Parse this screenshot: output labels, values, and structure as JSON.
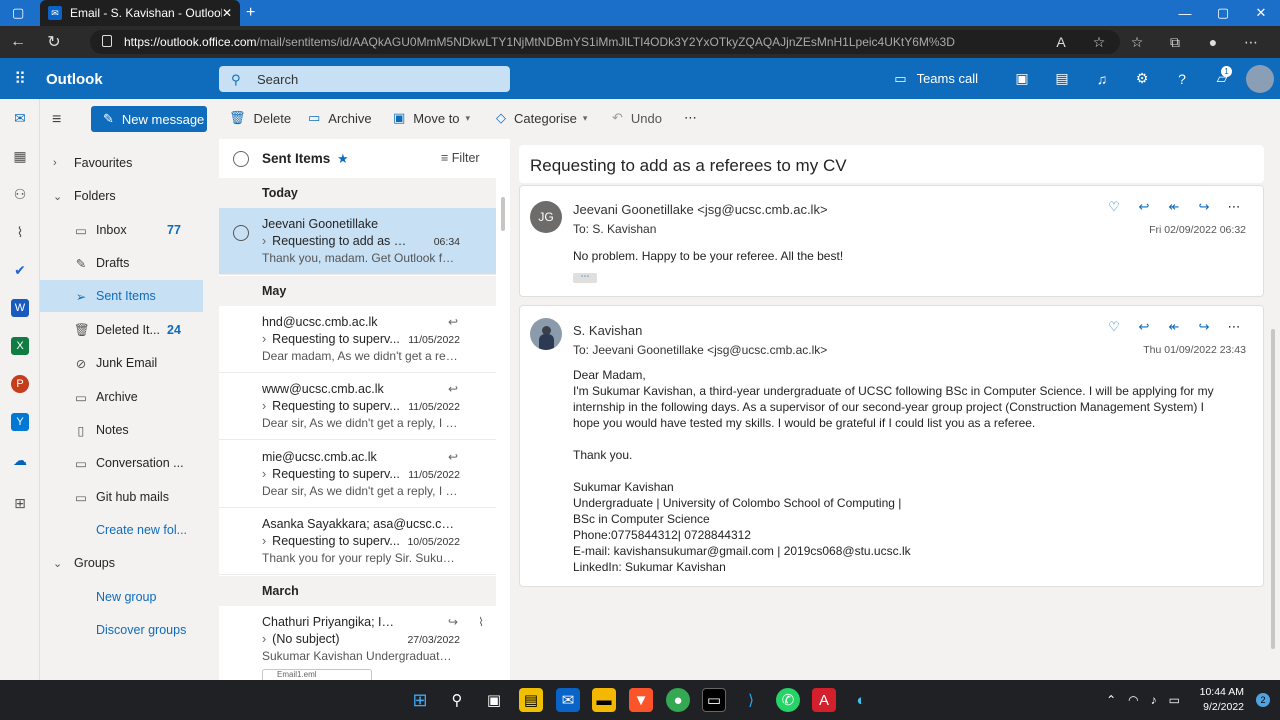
{
  "browser": {
    "tab_title": "Email - S. Kavishan - Outlook",
    "url_host": "https://outlook.office.com",
    "url_path": "/mail/sentitems/id/AAQkAGU0MmM5NDkwLTY1NjMtNDBmYS1iMmJlLTI4ODk3Y2YxOTkyZQAQAJjnZEsMnH1Lpeic4UKtY6M%3D"
  },
  "header": {
    "app_name": "Outlook",
    "search_placeholder": "Search",
    "teams_call": "Teams call",
    "notification_badge": "1"
  },
  "commands": {
    "new_message": "New message",
    "delete": "Delete",
    "archive": "Archive",
    "move_to": "Move to",
    "categorise": "Categorise",
    "undo": "Undo"
  },
  "folders": {
    "favourites": "Favourites",
    "folders": "Folders",
    "items": [
      {
        "label": "Inbox",
        "count": "77"
      },
      {
        "label": "Drafts",
        "count": ""
      },
      {
        "label": "Sent Items",
        "count": ""
      },
      {
        "label": "Deleted It...",
        "count": "24"
      },
      {
        "label": "Junk Email",
        "count": ""
      },
      {
        "label": "Archive",
        "count": ""
      },
      {
        "label": "Notes",
        "count": ""
      },
      {
        "label": "Conversation ...",
        "count": ""
      },
      {
        "label": "Git hub mails",
        "count": ""
      }
    ],
    "create_new": "Create new fol...",
    "groups": "Groups",
    "new_group": "New group",
    "discover_groups": "Discover groups"
  },
  "message_list": {
    "title": "Sent Items",
    "filter": "Filter",
    "groups": [
      "Today",
      "May",
      "March"
    ],
    "messages": [
      {
        "from": "Jeevani Goonetillake",
        "subject": "Requesting to add as a ref...",
        "date": "06:34",
        "preview": "Thank you, madam. Get Outlook for ..."
      },
      {
        "from": "hnd@ucsc.cmb.ac.lk",
        "subject": "Requesting to superv...",
        "date": "11/05/2022",
        "preview": "Dear madam, As we didn't get a repl..."
      },
      {
        "from": "www@ucsc.cmb.ac.lk",
        "subject": "Requesting to superv...",
        "date": "11/05/2022",
        "preview": "Dear sir, As we didn't get a reply, I re..."
      },
      {
        "from": "mie@ucsc.cmb.ac.lk",
        "subject": "Requesting to superv...",
        "date": "11/05/2022",
        "preview": "Dear sir, As we didn't get a reply, I re..."
      },
      {
        "from": "Asanka Sayakkara; asa@ucsc.cmb.ac....",
        "subject": "Requesting to superv...",
        "date": "10/05/2022",
        "preview": "Thank you for your reply Sir. Sukum..."
      },
      {
        "from": "Chathuri Priyangika; Imes...",
        "subject": "(No subject)",
        "date": "27/03/2022",
        "preview": "Sukumar Kavishan Undergraduate | ..."
      }
    ],
    "attachment": "Email1.eml"
  },
  "reading": {
    "subject": "Requesting to add as a referees to my CV",
    "mail1": {
      "initials": "JG",
      "sender": "Jeevani Goonetillake <jsg@ucsc.cmb.ac.lk>",
      "to": "To:  S. Kavishan",
      "when": "Fri 02/09/2022 06:32",
      "body": "No problem. Happy to be your referee. All the best!"
    },
    "mail2": {
      "sender": "S. Kavishan",
      "to": "To:  Jeevani Goonetillake <jsg@ucsc.cmb.ac.lk>",
      "when": "Thu 01/09/2022 23:43",
      "lines": [
        "Dear Madam,",
        "I'm Sukumar Kavishan, a third-year undergraduate of UCSC following BSc in Computer Science. I will be applying for my",
        "internship in the following days. As a supervisor of our second-year group project (Construction Management System) I",
        "hope you would have tested my skills. I would be grateful if I could list you as a referee.",
        "",
        "Thank you.",
        "",
        "Sukumar Kavishan",
        "Undergraduate | University of Colombo School of Computing |",
        "BSc in Computer Science",
        "Phone:0775844312| 0728844312",
        "E-mail: kavishansukumar@gmail.com | 2019cs068@stu.ucsc.lk",
        "LinkedIn: Sukumar Kavishan"
      ]
    }
  },
  "taskbar": {
    "time": "10:44 AM",
    "date": "9/2/2022",
    "notif_count": "2"
  },
  "colors": {
    "accent": "#0f6cbd",
    "selection": "#c7e0f4"
  }
}
